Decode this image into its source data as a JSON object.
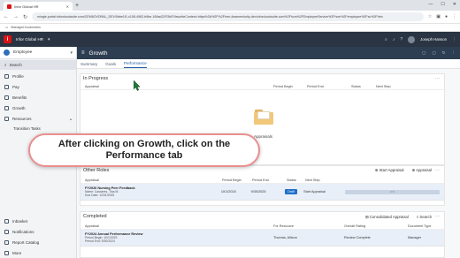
{
  "browser": {
    "tab_title": "Infor Global HR",
    "url": "mingle-portal.inforcloudsuite.com/CEM6OVDRAL_DEV/0bbe1f1-c108-4962-b9be-169ad22f78d0?favoriteContext=https%3A%2F%2Fhrm-4eamemlority-dev.inforcloudsuite.com%2Fhcm%2FEmployeeService%2Fhcm%2Femployee%2Fsc%2Fhtm",
    "managed_label": "Managed bookmarks"
  },
  "app": {
    "name": "Infor Global HR",
    "user_name": "Joseph Hanson"
  },
  "sidebar": {
    "role": "Employee",
    "search_label": "Search",
    "items": [
      {
        "label": "Profile"
      },
      {
        "label": "Pay"
      },
      {
        "label": "Benefits"
      },
      {
        "label": "Growth"
      },
      {
        "label": "Resources"
      }
    ],
    "sub_items": [
      {
        "label": "Transition Tasks"
      }
    ],
    "bottom_items": [
      {
        "label": "Inbasket"
      },
      {
        "label": "Notifications"
      },
      {
        "label": "Report Catalog"
      },
      {
        "label": "More"
      }
    ]
  },
  "page": {
    "title": "Growth",
    "tabs": [
      {
        "label": "Summary"
      },
      {
        "label": "Goals"
      },
      {
        "label": "Performance"
      }
    ],
    "active_tab": "Performance"
  },
  "in_progress": {
    "title": "In Progress",
    "columns": [
      "Appraisal",
      "Period Begin",
      "Period End",
      "Status",
      "Next Step"
    ],
    "empty_text": "Appraisals"
  },
  "other_roles": {
    "title": "Other Roles",
    "actions": [
      "Start Appraisal",
      "Appraisal"
    ],
    "columns": [
      "Appraisal",
      "Period Begin",
      "Period End",
      "Status",
      "Next Step"
    ],
    "rows": [
      {
        "appraisal": "FY2026 Nursing Peer Feedback",
        "sub1": "Name: Casseres, Tina M.",
        "sub2": "Due Date: 12/31/2025",
        "period_begin": "10/1/2024",
        "period_end": "9/30/2025",
        "status": "Draft",
        "next_step": "Start Appraisal",
        "progress": "0 %"
      }
    ]
  },
  "completed": {
    "title": "Completed",
    "actions": [
      "Consolidated Appraisal",
      "Search"
    ],
    "columns": [
      "Appraisal",
      "For Resource",
      "Overall Rating",
      "Document Type"
    ],
    "rows": [
      {
        "appraisal": "FY2024 Annual Performance Review",
        "sub1": "Period Begin: 10/1/2023",
        "sub2": "Period End: 9/30/2024",
        "resource": "Thomas, Allison",
        "rating": "Review Complete",
        "doc_type": "Manager"
      }
    ]
  },
  "caption": {
    "line1": "After clicking on Growth, click on the",
    "line2": "Performance tab"
  },
  "colors": {
    "app_header": "#2a3442",
    "main_header": "#2e3e52",
    "accent": "#1f5fa8",
    "caption_border": "#e98f8f",
    "row_highlight": "#e9eff8"
  }
}
